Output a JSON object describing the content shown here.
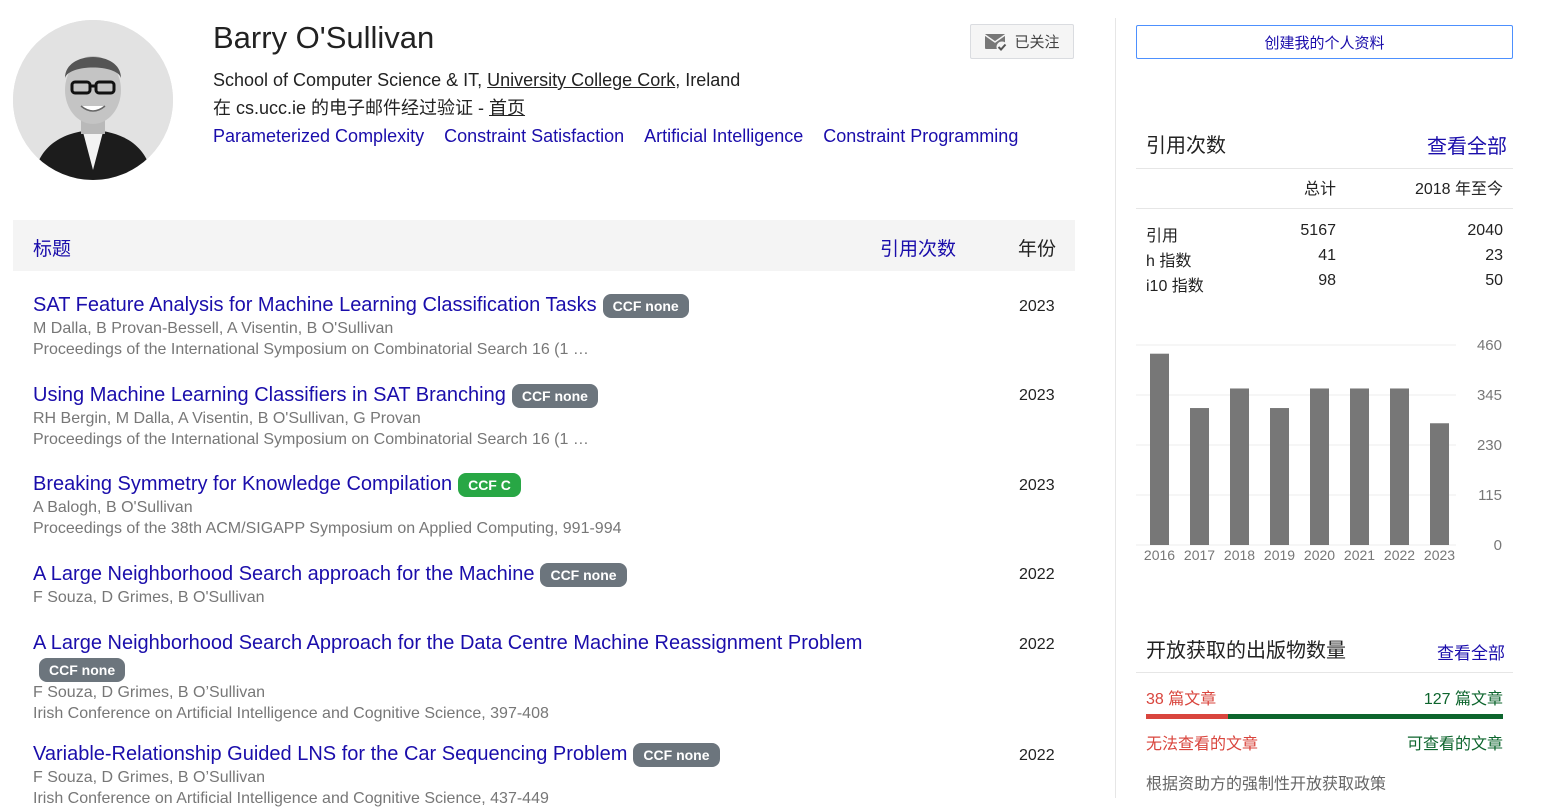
{
  "profile": {
    "name": "Barry O'Sullivan",
    "affiliation_prefix": "School of Computer Science & IT, ",
    "affiliation_link": "University College Cork",
    "affiliation_suffix": ", Ireland",
    "verified_text": "在 cs.ucc.ie 的电子邮件经过验证 - ",
    "homepage_label": "首页",
    "interests": [
      "Parameterized Complexity",
      "Constraint Satisfaction",
      "Artificial Intelligence",
      "Constraint Programming"
    ],
    "follow_label": "已关注"
  },
  "table": {
    "col_title": "标题",
    "col_cited": "引用次数",
    "col_year": "年份"
  },
  "publications": [
    {
      "title": "SAT Feature Analysis for Machine Learning Classification Tasks",
      "badge": "CCF none",
      "authors": "M Dalla, B Provan-Bessell, A Visentin, B O'Sullivan",
      "venue": "Proceedings of the International Symposium on Combinatorial Search 16 (1 …",
      "year": "2023"
    },
    {
      "title": "Using Machine Learning Classifiers in SAT Branching",
      "badge": "CCF none",
      "authors": "RH Bergin, M Dalla, A Visentin, B O'Sullivan, G Provan",
      "venue": "Proceedings of the International Symposium on Combinatorial Search 16 (1 …",
      "year": "2023"
    },
    {
      "title": "Breaking Symmetry for Knowledge Compilation",
      "badge": "CCF C",
      "authors": "A Balogh, B O'Sullivan",
      "venue": "Proceedings of the 38th ACM/SIGAPP Symposium on Applied Computing, 991-994",
      "year": "2023"
    },
    {
      "title": "A Large Neighborhood Search approach for the Machine",
      "badge": "CCF none",
      "authors": "F Souza, D Grimes, B O'Sullivan",
      "venue": "",
      "year": "2022"
    },
    {
      "title": "A Large Neighborhood Search Approach for the Data Centre Machine Reassignment Problem",
      "badge": "CCF none",
      "authors": "F Souza, D Grimes, B O’Sullivan",
      "venue": "Irish Conference on Artificial Intelligence and Cognitive Science, 397-408",
      "year": "2022"
    },
    {
      "title": "Variable-Relationship Guided LNS for the Car Sequencing Problem",
      "badge": "CCF none",
      "authors": "F Souza, D Grimes, B O’Sullivan",
      "venue": "Irish Conference on Artificial Intelligence and Cognitive Science, 437-449",
      "year": "2022"
    }
  ],
  "sidebar": {
    "create_label": "创建我的个人资料",
    "cited_heading": "引用次数",
    "view_all": "查看全部",
    "col_total": "总计",
    "col_since": "2018 年至今",
    "rows": [
      {
        "label": "引用",
        "total": "5167",
        "since": "2040"
      },
      {
        "label": "h 指数",
        "total": "41",
        "since": "23"
      },
      {
        "label": "i10 指数",
        "total": "98",
        "since": "50"
      }
    ],
    "oa_heading": "开放获取的出版物数量",
    "oa_view_all": "查看全部",
    "oa_unavailable_count": "38 篇文章",
    "oa_available_count": "127 篇文章",
    "oa_unavailable_label": "无法查看的文章",
    "oa_available_label": "可查看的文章",
    "oa_unavailable": 38,
    "oa_available": 127,
    "oa_mandate": "根据资助方的强制性开放获取政策",
    "colors": {
      "unavailable": "#d9453d",
      "available": "#0d652d"
    }
  },
  "chart_data": {
    "type": "bar",
    "categories": [
      "2016",
      "2017",
      "2018",
      "2019",
      "2020",
      "2021",
      "2022",
      "2023"
    ],
    "values": [
      440,
      315,
      360,
      315,
      360,
      360,
      360,
      280
    ],
    "yticks": [
      "0",
      "115",
      "230",
      "345",
      "460"
    ],
    "ylim": [
      0,
      460
    ],
    "color": "#777777",
    "grid": true
  }
}
